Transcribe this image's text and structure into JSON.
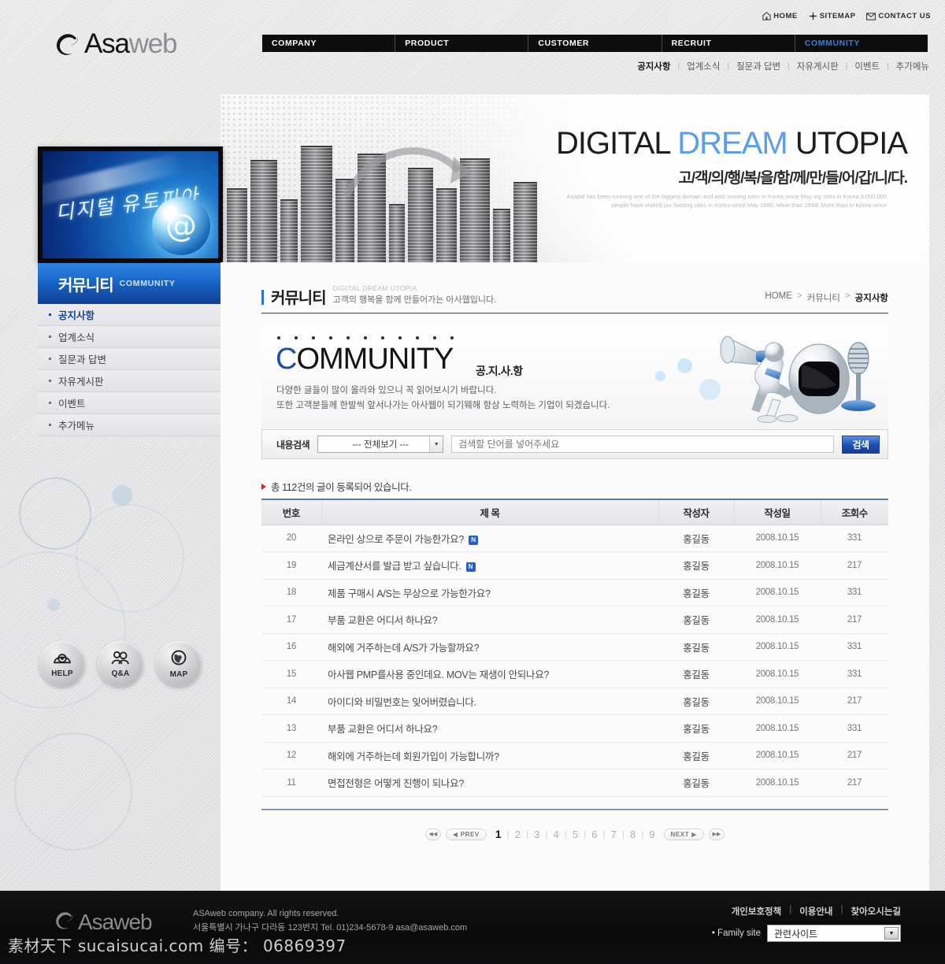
{
  "brand": {
    "name_dark": "Asa",
    "name_gray": "web",
    "logo_icon": "e-swirl-logo-icon"
  },
  "utility": [
    {
      "label": "HOME",
      "icon": "home-icon"
    },
    {
      "label": "SITEMAP",
      "icon": "sitemap-icon"
    },
    {
      "label": "CONTACT US",
      "icon": "mail-icon"
    }
  ],
  "gnb": [
    {
      "label": "COMPANY",
      "active": false
    },
    {
      "label": "PRODUCT",
      "active": false
    },
    {
      "label": "CUSTOMER",
      "active": false
    },
    {
      "label": "RECRUIT",
      "active": false
    },
    {
      "label": "COMMUNITY",
      "active": true
    }
  ],
  "subnav": [
    "공지사항",
    "업계소식",
    "질문과 답변",
    "자유게시판",
    "이벤트",
    "추가메뉴"
  ],
  "hero": {
    "title_1": "DIGITAL ",
    "title_2": "DREAM",
    "title_3": " UTOPIA",
    "subtitle": "고/객/의/행/복/을/함/께/만/들/어/갑/니/다.",
    "paragraph": "Asadal has been running one of the biggest domain and web hosting sites in Korea since May ing sites in Korea 3,000,000 people have visited our hosting sites in Korea since May 1998. More than 1998. More than in Korea since"
  },
  "left_banner": {
    "script": "디지털 유토피아",
    "globe_glyph": "@"
  },
  "category": {
    "ko": "커뮤니티",
    "en": "COMMUNITY"
  },
  "lnb": [
    {
      "label": "공지사항",
      "active": true
    },
    {
      "label": "업계소식",
      "active": false
    },
    {
      "label": "질문과 답변",
      "active": false
    },
    {
      "label": "자유게시판",
      "active": false
    },
    {
      "label": "이벤트",
      "active": false
    },
    {
      "label": "추가메뉴",
      "active": false
    }
  ],
  "quick": [
    {
      "label": "HELP",
      "icon": "telephone-icon"
    },
    {
      "label": "Q&A",
      "icon": "people-icon"
    },
    {
      "label": "MAP",
      "icon": "globe-icon"
    }
  ],
  "page": {
    "title_ko": "커뮤니티",
    "title_en": "DIGITAL DREAM UTOPIA",
    "title_desc": "고객의 행복을 함께 만들어가는 아사웹입니다.",
    "breadcrumb": {
      "home": "HOME",
      "level1": "커뮤니티",
      "current": "공지사항"
    }
  },
  "visual": {
    "big_first": "C",
    "big_rest": "OMMUNITY",
    "ko_badge": "공.지.사.항",
    "line1": "다양한 글들이 많이 올라와 있으니 꼭 읽어보시기 바랍니다.",
    "line2": "또한 고객분들께 한발씩 앞서나가는 아사웹이 되기웨해 항상 노력하는 기업이 되겠습니다.",
    "mascot_icon": "megaphone-character-icon"
  },
  "search": {
    "label": "내용검색",
    "select_value": "--- 전체보기 ---",
    "placeholder": "검색할 단어를 넣어주세요",
    "button": "검색"
  },
  "total_text": "총 112건의 글이 등록되어 있습니다.",
  "table": {
    "headers": [
      "번호",
      "제 목",
      "작성자",
      "작성일",
      "조회수"
    ],
    "rows": [
      {
        "no": "20",
        "subject": "온라인 상으로 주문이 가능한가요?",
        "new": true,
        "author": "홍길동",
        "date": "2008.10.15",
        "hits": "331"
      },
      {
        "no": "19",
        "subject": "세금계산서를 발급 받고 싶습니다.",
        "new": true,
        "author": "홍길동",
        "date": "2008.10.15",
        "hits": "217"
      },
      {
        "no": "18",
        "subject": "제품 구매시 A/S는 무상으로 가능한가요?",
        "new": false,
        "author": "홍길동",
        "date": "2008.10.15",
        "hits": "331"
      },
      {
        "no": "17",
        "subject": "부품 교환은 어디서 하나요?",
        "new": false,
        "author": "홍길동",
        "date": "2008.10.15",
        "hits": "217"
      },
      {
        "no": "16",
        "subject": "해외에 거주하는데 A/S가 가능할까요?",
        "new": false,
        "author": "홍길동",
        "date": "2008.10.15",
        "hits": "331"
      },
      {
        "no": "15",
        "subject": "아사웹 PMP를사용 중인데요. MOV는 재생이 안되나요?",
        "new": false,
        "author": "홍길동",
        "date": "2008.10.15",
        "hits": "331"
      },
      {
        "no": "14",
        "subject": "아이디와 비밀번호는 잊어버렸습니다.",
        "new": false,
        "author": "홍길동",
        "date": "2008.10.15",
        "hits": "217"
      },
      {
        "no": "13",
        "subject": "부품 교환은 어디서 하나요?",
        "new": false,
        "author": "홍길동",
        "date": "2008.10.15",
        "hits": "331"
      },
      {
        "no": "12",
        "subject": "해외에 거주하는데 회원가입이 가능합니까?",
        "new": false,
        "author": "홍길동",
        "date": "2008.10.15",
        "hits": "217"
      },
      {
        "no": "11",
        "subject": "면접전형은 어떻게 진행이 되나요?",
        "new": false,
        "author": "홍길동",
        "date": "2008.10.15",
        "hits": "217"
      }
    ],
    "new_badge": "N"
  },
  "pager": {
    "first": "◀◀",
    "prev": "PREV",
    "next": "NEXT",
    "last": "▶▶",
    "pages": [
      "1",
      "2",
      "3",
      "4",
      "5",
      "6",
      "7",
      "8",
      "9"
    ],
    "current": "1"
  },
  "footer": {
    "logo_dark": "Asa",
    "logo_gray": "web",
    "copyright": "ASAweb company. All rights reserved.",
    "address": "서울특별시 가나구 다라동 123번지 Tel. 01)234-5678-9 asa@asaweb.com",
    "links": [
      "개인보호정책",
      "이용안내",
      "찾아오시는길"
    ],
    "family_label": "Family site",
    "family_value": "관련사이트"
  },
  "watermark": "素材天下 sucaisucai.com 编号： 06869397",
  "colors": {
    "accent_blue": "#1f4fb4",
    "nav_active": "#3a7fe0",
    "category_blue": "#1763c6",
    "table_rule": "#5a7ea6",
    "badge_blue": "#2b5fc4"
  }
}
